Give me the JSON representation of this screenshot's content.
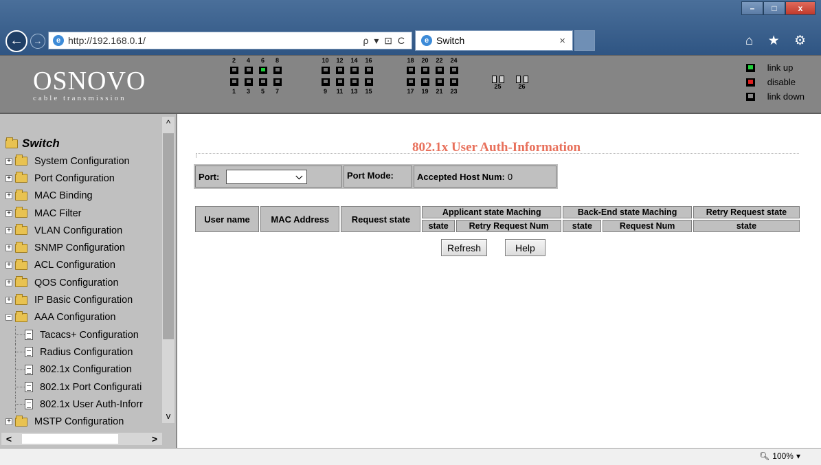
{
  "browser": {
    "url": "http://192.168.0.1/",
    "address_tools": "ρ ▾ ⊡ C",
    "tab_title": "Switch",
    "tab_close": "×",
    "back_glyph": "←",
    "forward_glyph": "→",
    "window_buttons": {
      "minimize": "–",
      "restore": "□",
      "close": "x"
    },
    "toolbar_icons": "⌂ ★ ⚙"
  },
  "header": {
    "brand_name": "OSNOVO",
    "brand_sub": "cable transmission",
    "port_groups": [
      {
        "top": [
          "2",
          "4",
          "6",
          "8"
        ],
        "bottom": [
          "1",
          "3",
          "5",
          "7"
        ]
      },
      {
        "top": [
          "10",
          "12",
          "14",
          "16"
        ],
        "bottom": [
          "9",
          "11",
          "13",
          "15"
        ]
      },
      {
        "top": [
          "18",
          "20",
          "22",
          "24"
        ],
        "bottom": [
          "17",
          "19",
          "21",
          "23"
        ]
      }
    ],
    "link_up_port": "6",
    "sfp_ports": [
      "25",
      "26"
    ],
    "legend": [
      {
        "state": "up",
        "label": "link up",
        "color": "#1fd13a"
      },
      {
        "state": "disable",
        "label": "disable",
        "color": "#e02020"
      },
      {
        "state": "down",
        "label": "link down",
        "color": "#888888"
      }
    ]
  },
  "sidebar": {
    "root_label": "Switch",
    "items": [
      {
        "label": "System Configuration"
      },
      {
        "label": "Port Configuration"
      },
      {
        "label": "MAC Binding"
      },
      {
        "label": "MAC Filter"
      },
      {
        "label": "VLAN Configuration"
      },
      {
        "label": "SNMP Configuration"
      },
      {
        "label": "ACL Configuration"
      },
      {
        "label": "QOS Configuration"
      },
      {
        "label": "IP Basic Configuration"
      },
      {
        "label": "AAA Configuration",
        "expanded": true
      },
      {
        "label": "MSTP Configuration"
      }
    ],
    "aaa_children": [
      {
        "label": "Tacacs+ Configuration"
      },
      {
        "label": "Radius Configuration"
      },
      {
        "label": "802.1x Configuration"
      },
      {
        "label": "802.1x Port Configurati"
      },
      {
        "label": "802.1x User Auth-Inforr"
      }
    ],
    "scroll": {
      "up": "^",
      "down": "v",
      "left": "<",
      "right": ">"
    }
  },
  "main": {
    "title": "802.1x User Auth-Information",
    "port_label": "Port:",
    "port_value": "",
    "port_mode_label": "Port Mode:",
    "accepted_host_label": "Accepted Host Num:",
    "accepted_host_value": "0",
    "table": {
      "col_user_name": "User name",
      "col_mac": "MAC Address",
      "col_request_state": "Request state",
      "group_applicant": "Applicant state Maching",
      "group_backend": "Back-End state Maching",
      "group_retry": "Retry Request state",
      "sub_state_1": "state",
      "sub_retry_num": "Retry Request Num",
      "sub_state_2": "state",
      "sub_request_num": "Request Num",
      "sub_state_3": "state",
      "rows": []
    },
    "buttons": {
      "refresh": "Refresh",
      "help": "Help"
    }
  },
  "status": {
    "zoom": "100%"
  }
}
